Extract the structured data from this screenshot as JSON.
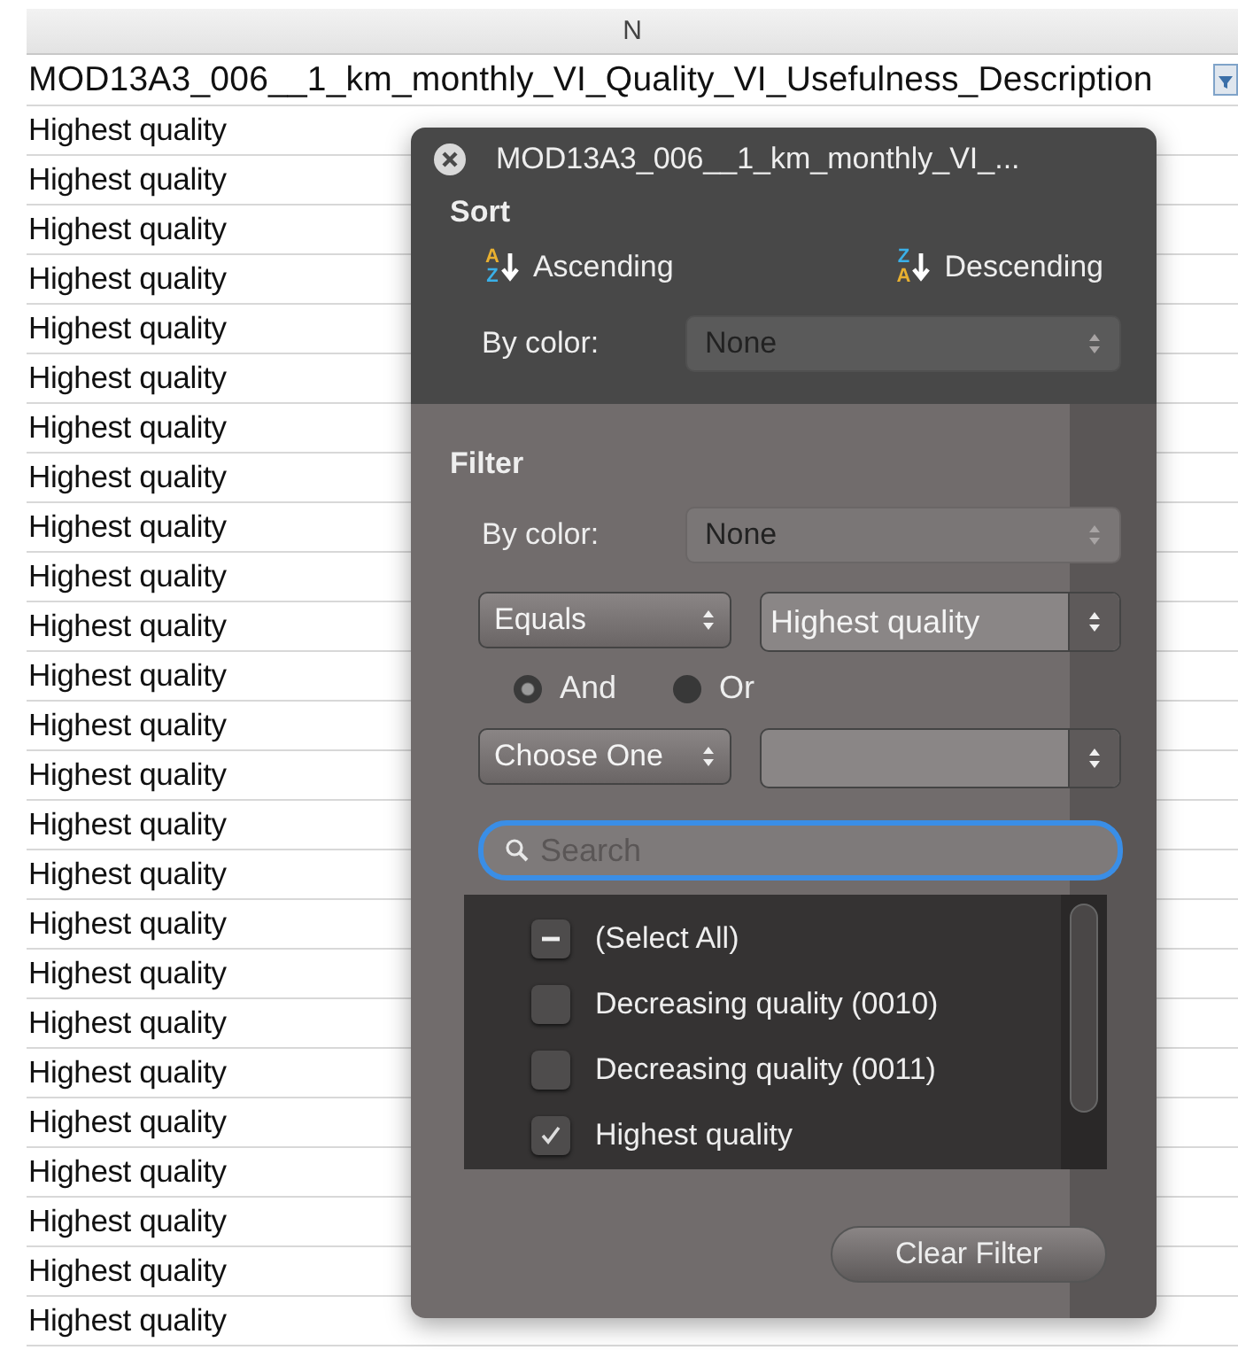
{
  "column_header": "N",
  "header_cell": "MOD13A3_006__1_km_monthly_VI_Quality_VI_Usefulness_Description",
  "rows": [
    "Highest quality",
    "Highest quality",
    "Highest quality",
    "Highest quality",
    "Highest quality",
    "Highest quality",
    "Highest quality",
    "Highest quality",
    "Highest quality",
    "Highest quality",
    "Highest quality",
    "Highest quality",
    "Highest quality",
    "Highest quality",
    "Highest quality",
    "Highest quality",
    "Highest quality",
    "Highest quality",
    "Highest quality",
    "Highest quality",
    "Highest quality",
    "Highest quality",
    "Highest quality",
    "Highest quality",
    "Highest quality"
  ],
  "popover": {
    "title": "MOD13A3_006__1_km_monthly_VI_...",
    "sort": {
      "heading": "Sort",
      "buttons": [
        {
          "label": "Ascending",
          "icon": {
            "top": "A",
            "bottom": "Z"
          }
        },
        {
          "label": "Descending",
          "icon": {
            "top": "Z",
            "bottom": "A"
          }
        }
      ],
      "by_color_label": "By color:",
      "by_color_value": "None"
    },
    "filter": {
      "heading": "Filter",
      "by_color_label": "By color:",
      "by_color_value": "None",
      "operator": "Equals",
      "value": "Highest quality",
      "conjunctions": [
        {
          "label": "And",
          "selected": true
        },
        {
          "label": "Or",
          "selected": false
        }
      ],
      "operator_2": "Choose One",
      "search": {
        "placeholder": "Search"
      },
      "items": [
        {
          "label": "(Select All)",
          "checked": false,
          "indeterminate": true
        },
        {
          "label": "Decreasing quality (0010)",
          "checked": false,
          "indeterminate": false
        },
        {
          "label": "Decreasing quality (0011)",
          "checked": false,
          "indeterminate": false
        },
        {
          "label": "Highest quality",
          "checked": true,
          "indeterminate": false
        }
      ],
      "clear_button": "Clear Filter"
    }
  }
}
